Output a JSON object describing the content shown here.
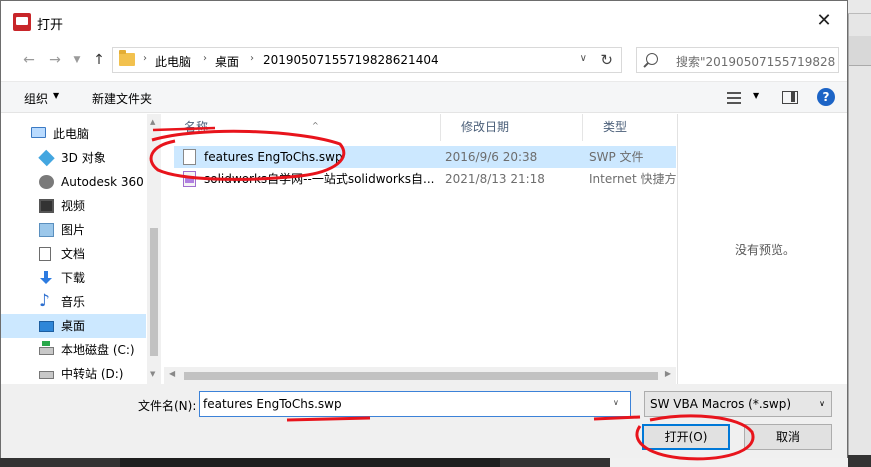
{
  "window": {
    "title": "打开",
    "close_glyph": "✕"
  },
  "address": {
    "crumbs": [
      "此电脑",
      "桌面",
      "20190507155719828621404"
    ],
    "crumb_sep": "›",
    "search_placeholder": "搜索\"20190507155719828..."
  },
  "toolbar": {
    "organize_label": "组织",
    "new_folder_label": "新建文件夹"
  },
  "nav_pane": {
    "items": [
      {
        "label": "此电脑",
        "icon": "computer-icon"
      },
      {
        "label": "3D 对象",
        "icon": "cube-3d-icon"
      },
      {
        "label": "Autodesk 360",
        "icon": "autodesk-icon"
      },
      {
        "label": "视频",
        "icon": "video-icon"
      },
      {
        "label": "图片",
        "icon": "picture-icon"
      },
      {
        "label": "文档",
        "icon": "document-icon"
      },
      {
        "label": "下载",
        "icon": "download-icon"
      },
      {
        "label": "音乐",
        "icon": "music-icon"
      },
      {
        "label": "桌面",
        "icon": "desktop-icon",
        "selected": true
      },
      {
        "label": "本地磁盘 (C:)",
        "icon": "drive-c-icon"
      },
      {
        "label": "中转站 (D:)",
        "icon": "drive-d-icon"
      }
    ]
  },
  "file_list": {
    "columns": [
      "名称",
      "修改日期",
      "类型"
    ],
    "rows": [
      {
        "name": "features EngToChs.swp",
        "date": "2016/9/6 20:38",
        "type": "SWP 文件",
        "selected": true
      },
      {
        "name": "solidworks自学网--一站式solidworks自...",
        "date": "2021/8/13 21:18",
        "type": "Internet 快捷方式",
        "selected": false
      }
    ]
  },
  "preview": {
    "text": "没有预览。"
  },
  "bottom": {
    "filename_label": "文件名(N):",
    "filename_value": "features EngToChs.swp",
    "filetype_value": "SW VBA Macros (*.swp)",
    "open_label": "打开(O)",
    "cancel_label": "取消"
  },
  "colors": {
    "selection": "#cce8ff",
    "accent": "#0078d7",
    "annotation": "#e8141c"
  }
}
